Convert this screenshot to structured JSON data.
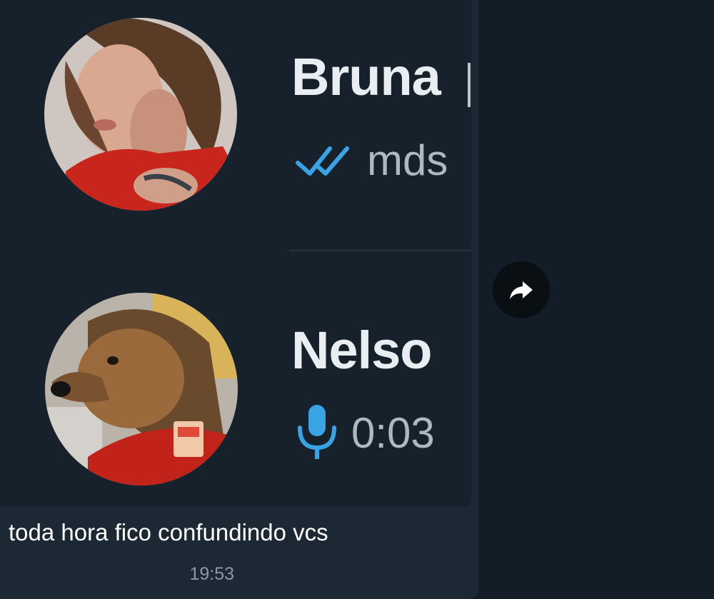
{
  "forwarded_message": {
    "contacts": [
      {
        "name": "Bruna",
        "preview_text": "mds",
        "status_icon": "double-check-icon"
      },
      {
        "name": "Nelso",
        "preview_text": "0:03",
        "status_icon": "microphone-icon"
      }
    ],
    "caption": "toda hora fico confundindo vcs",
    "time": "19:53"
  },
  "actions": {
    "share_icon": "share-arrow-icon"
  },
  "colors": {
    "background": "#131d27",
    "bubble": "#1c2834",
    "accent": "#3aa3e3",
    "name_text": "#e9eef3"
  }
}
